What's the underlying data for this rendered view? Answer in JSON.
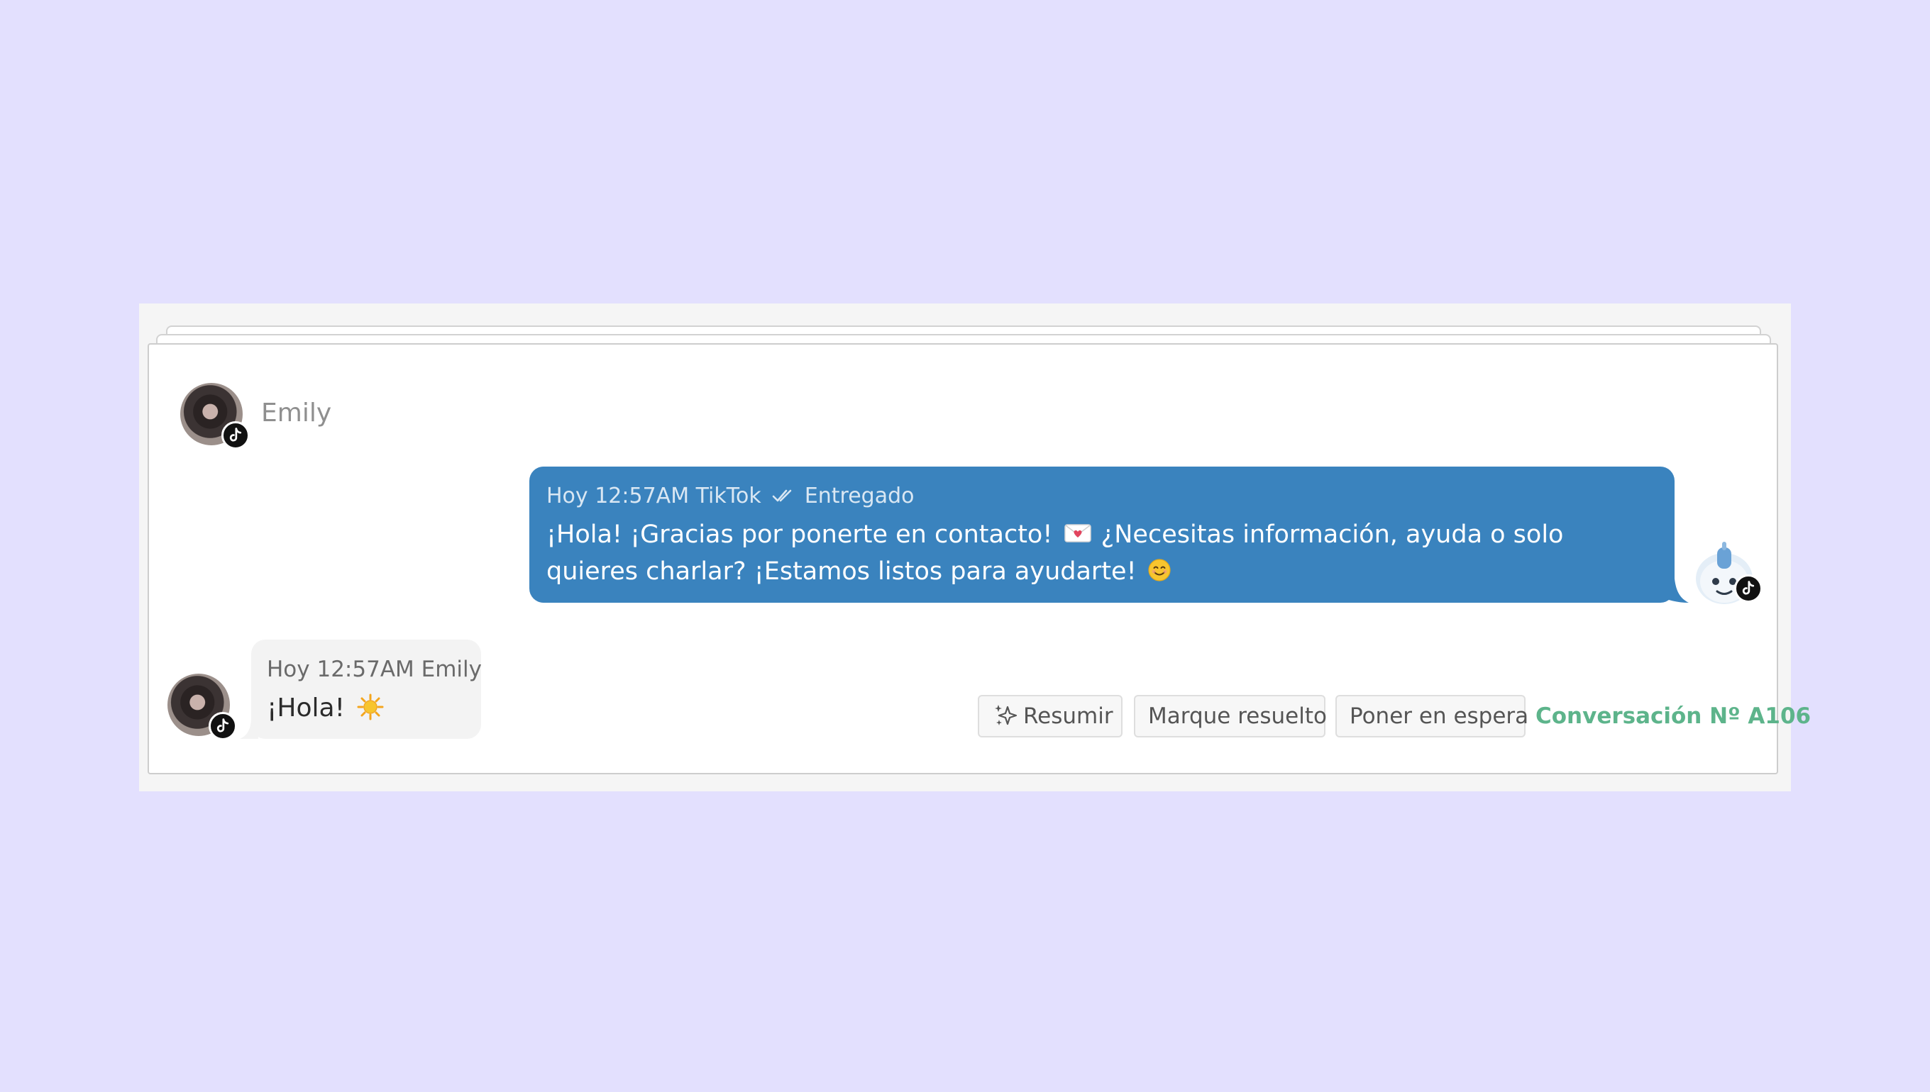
{
  "contact": {
    "name": "Emily",
    "channel_icon": "tiktok-icon",
    "avatar_icon": "contact-avatar"
  },
  "outgoing_message": {
    "day": "Hoy",
    "time": "12:57AM",
    "channel": "TikTok",
    "status_icon": "double-check-icon",
    "status": "Entregado",
    "text_part1": "¡Hola! ¡Gracias por ponerte en contacto!",
    "text_part2": "¿Necesitas información, ayuda o solo quieres charlar? ¡Estamos listos para ayudarte!",
    "emoji_1": "love-letter-icon",
    "emoji_2": "smiling-face-icon",
    "bubble_color": "#3a83be"
  },
  "incoming_message": {
    "day": "Hoy",
    "time": "12:57AM",
    "sender": "Emily",
    "text": "¡Hola!",
    "emoji": "sun-icon",
    "bubble_color": "#f3f3f3"
  },
  "bot": {
    "avatar_icon": "robot-icon",
    "channel_icon": "tiktok-icon"
  },
  "actions": {
    "summarize_icon": "sparkles-icon",
    "summarize_label": "Resumir",
    "resolve_label": "Marque resuelto",
    "hold_label": "Poner en espera"
  },
  "conversation": {
    "label": "Conversación Nº A106",
    "color": "#5db48b"
  },
  "colors": {
    "background": "#e3e0fe",
    "panel": "#f5f5f5",
    "card": "#ffffff"
  }
}
